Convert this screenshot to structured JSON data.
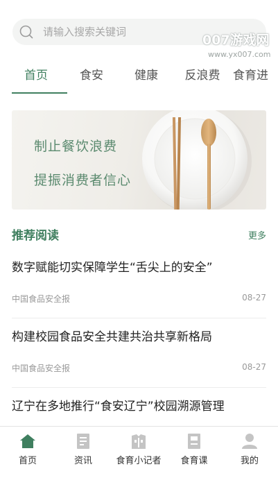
{
  "search": {
    "placeholder": "请输入搜索关键词",
    "icon": "search-icon"
  },
  "watermark": {
    "brand": "007游戏网",
    "url": "www.yx007.com"
  },
  "tabs": [
    {
      "label": "首页",
      "active": true
    },
    {
      "label": "食安",
      "active": false
    },
    {
      "label": "健康",
      "active": false
    },
    {
      "label": "反浪费",
      "active": false
    },
    {
      "label": "食育进",
      "active": false
    }
  ],
  "banner": {
    "line1": "制止餐饮浪费",
    "line2": "提振消费者信心"
  },
  "recommended": {
    "title": "推荐阅读",
    "more": "更多",
    "articles": [
      {
        "title": "数字赋能切实保障学生“舌尖上的安全”",
        "source": "中国食品安全报",
        "date": "08-27"
      },
      {
        "title": "构建校园食品安全共建共治共享新格局",
        "source": "中国食品安全报",
        "date": "08-27"
      },
      {
        "title": "辽宁在多地推行“食安辽宁”校园溯源管理",
        "source": "",
        "date": ""
      }
    ]
  },
  "bottom_nav": [
    {
      "label": "首页",
      "icon": "home-icon",
      "active": true
    },
    {
      "label": "资讯",
      "icon": "news-icon",
      "active": false
    },
    {
      "label": "食育小记者",
      "icon": "reporter-icon",
      "active": false
    },
    {
      "label": "食育课",
      "icon": "course-icon",
      "active": false
    },
    {
      "label": "我的",
      "icon": "profile-icon",
      "active": false
    }
  ],
  "colors": {
    "accent": "#3f7f5f",
    "inactive_icon": "#c4c4c4",
    "text": "#222222",
    "muted": "#999999"
  }
}
